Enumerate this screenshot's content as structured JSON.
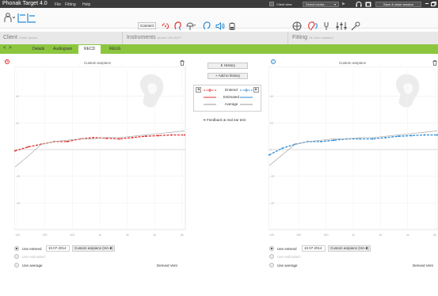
{
  "titlebar": {
    "app_title": "Phonak Target 4.0",
    "menu": [
      "File",
      "Fitting",
      "Help"
    ],
    "client_view": "Client view",
    "select_media": "Select media...",
    "save_close": "Save & close session"
  },
  "toolbar": {
    "connect": "Connect"
  },
  "sections": {
    "client": {
      "label": "Client",
      "sub": "Smith James"
    },
    "instruments": {
      "label": "Instruments",
      "sub": "Audéo V90-312T"
    },
    "fitting": {
      "label": "Fitting",
      "sub": "Of Calm situation"
    }
  },
  "tabs": {
    "arrows": "< >",
    "items": [
      "Details",
      "Audiogram",
      "RECD",
      "REUG"
    ],
    "active": "RECD"
  },
  "left_panel": {
    "badge": "R",
    "title": "Custom earpiece",
    "color": "#e03030"
  },
  "right_panel": {
    "badge": "L",
    "title": "Custom earpiece",
    "color": "#2a8ad4"
  },
  "center": {
    "history": "History",
    "add_to_history": "Add to history",
    "legend": {
      "entered": "Entered",
      "estimated": "Estimated",
      "average": "Average"
    },
    "feedback": "Feedback & real ear test"
  },
  "options": {
    "use_entered": "Use entered",
    "date": "10.07.2014",
    "earpiece": "Custom earpiece (HA-2)",
    "use_estimated": "Use estimated",
    "use_average": "Use average",
    "derived_vent": "Derived Vent"
  },
  "chart_data": [
    {
      "type": "line",
      "title": "Custom earpiece",
      "ear": "right",
      "x": [
        "125",
        "250",
        "500",
        "1k",
        "2k",
        "4k",
        "8k"
      ],
      "ylim": [
        -60,
        60
      ],
      "yticks": [
        "40",
        "20",
        "0",
        "-20",
        "-40"
      ],
      "series": [
        {
          "name": "Entered",
          "color": "#e03030",
          "dashed": true,
          "values": [
            -1,
            2,
            4,
            6,
            6,
            8,
            9,
            8.5,
            8,
            9,
            10,
            10.5,
            11,
            11
          ]
        },
        {
          "name": "Estimated",
          "color": "#aaaaaa",
          "values": [
            -13,
            -5,
            4,
            6,
            7,
            8,
            8,
            9,
            9,
            10,
            11,
            12,
            13,
            14
          ]
        }
      ]
    },
    {
      "type": "line",
      "title": "Custom earpiece",
      "ear": "left",
      "x": [
        "125",
        "250",
        "500",
        "1k",
        "2k",
        "4k",
        "8k"
      ],
      "ylim": [
        -60,
        60
      ],
      "yticks": [
        "40",
        "20",
        "0",
        "-20",
        "-40"
      ],
      "series": [
        {
          "name": "Entered",
          "color": "#2a8ad4",
          "dashed": true,
          "values": [
            -4,
            1,
            4,
            6,
            6,
            7,
            8,
            8,
            8,
            9,
            10,
            10.5,
            11,
            11
          ]
        },
        {
          "name": "Estimated",
          "color": "#aaaaaa",
          "values": [
            -12,
            -4,
            4,
            6,
            7,
            8,
            8,
            9,
            9,
            10,
            11,
            12,
            13,
            14
          ]
        }
      ]
    }
  ]
}
